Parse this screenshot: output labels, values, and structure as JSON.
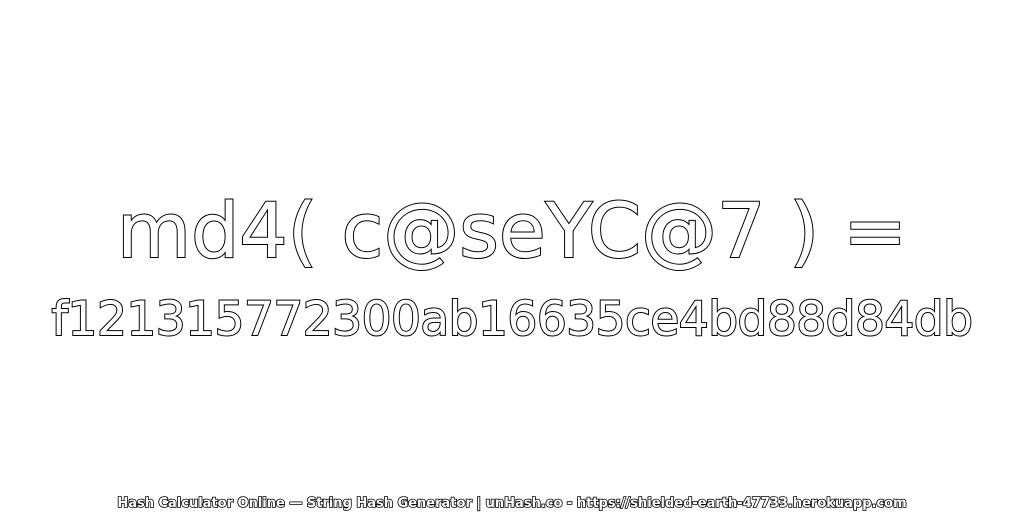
{
  "expression": "md4( c@seYC@7 ) =",
  "hash_value": "f121315772300ab16635ce4bd88d84db",
  "footer_text": "Hash Calculator Online — String Hash Generator | unHash.co - https://shielded-earth-47733.herokuapp.com"
}
